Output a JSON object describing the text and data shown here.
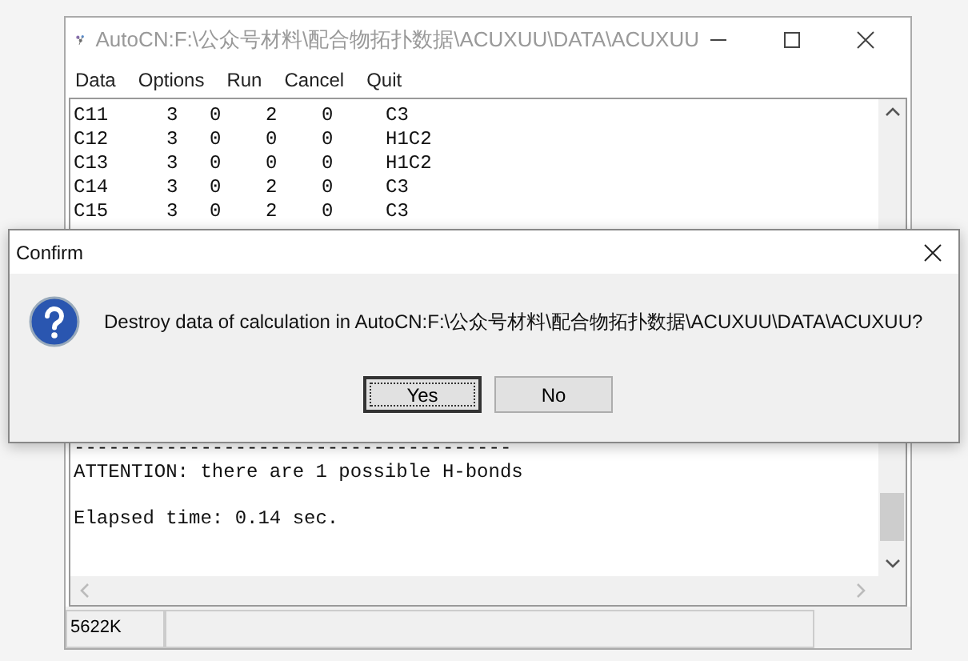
{
  "window": {
    "title": "AutoCN:F:\\公众号材料\\配合物拓扑数据\\ACUXUU\\DATA\\ACUXUU"
  },
  "menu": [
    "Data",
    "Options",
    "Run",
    "Cancel",
    "Quit"
  ],
  "output": {
    "rows": [
      {
        "cells": [
          "C11",
          "3",
          "0",
          "2",
          "0",
          "C3"
        ]
      },
      {
        "cells": [
          "C12",
          "3",
          "0",
          "0",
          "0",
          "H1C2"
        ]
      },
      {
        "cells": [
          "C13",
          "3",
          "0",
          "0",
          "0",
          "H1C2"
        ]
      },
      {
        "cells": [
          "C14",
          "3",
          "0",
          "2",
          "0",
          "C3"
        ]
      },
      {
        "cells": [
          "C15",
          "3",
          "0",
          "2",
          "0",
          "C3"
        ]
      }
    ],
    "paragraphs": [
      [
        "--------------------------------------",
        "ATTENTION: there are 1 possible H-bonds"
      ],
      [
        "Elapsed time: 0.14 sec."
      ]
    ]
  },
  "status_bar": {
    "memory": "5622K"
  },
  "dialog": {
    "title": "Confirm",
    "message": "Destroy data of calculation in AutoCN:F:\\公众号材料\\配合物拓扑数据\\ACUXUU\\DATA\\ACUXUU?",
    "buttons": [
      {
        "label": "Yes",
        "focused": true
      },
      {
        "label": "No",
        "focused": false
      }
    ]
  }
}
